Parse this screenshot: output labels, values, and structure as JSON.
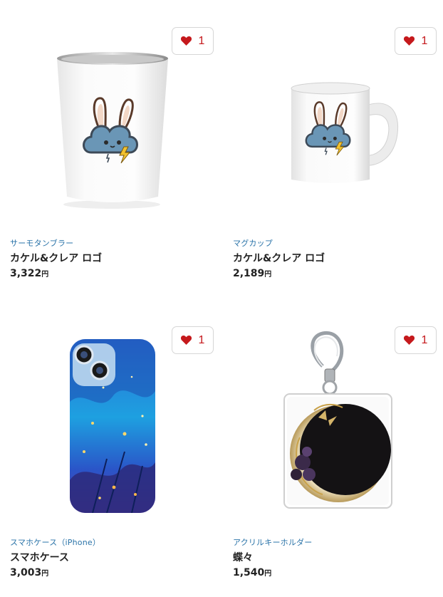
{
  "like_icon": "heart-icon",
  "accent_color": "#c5191c",
  "category_color": "#2a73a8",
  "products": [
    {
      "category": "サーモタンブラー",
      "title": "カケル&クレア ロゴ",
      "price": "3,322",
      "currency": "円",
      "likes": "1",
      "image": "thermo-tumbler-image"
    },
    {
      "category": "マグカップ",
      "title": "カケル&クレア ロゴ",
      "price": "2,189",
      "currency": "円",
      "likes": "1",
      "image": "mug-image"
    },
    {
      "category": "スマホケース（iPhone）",
      "title": "スマホケース",
      "price": "3,003",
      "currency": "円",
      "likes": "1",
      "image": "phone-case-image"
    },
    {
      "category": "アクリルキーホルダー",
      "title": "蝶々",
      "price": "1,540",
      "currency": "円",
      "likes": "1",
      "image": "acrylic-keychain-image"
    }
  ]
}
